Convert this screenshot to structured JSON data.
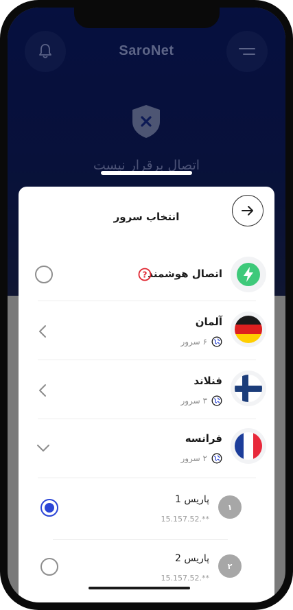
{
  "header": {
    "brand": "SaroNet",
    "status": "اتصال برقرار نیست"
  },
  "sheet": {
    "title": "انتخاب سرور"
  },
  "smart": {
    "label": "اتصال هوشمند",
    "help_glyph": "?"
  },
  "countries": [
    {
      "name": "آلمان",
      "servers": "۶ سرور",
      "expanded": false
    },
    {
      "name": "فنلاند",
      "servers": "۳ سرور",
      "expanded": false
    },
    {
      "name": "فرانسه",
      "servers": "۲ سرور",
      "expanded": true
    }
  ],
  "subservers": [
    {
      "name": "پاریس 1",
      "ip": "15.157.52.**",
      "badge": "۱",
      "selected": true
    },
    {
      "name": "پاریس 2",
      "ip": "15.157.52.**",
      "badge": "۲",
      "selected": false
    }
  ],
  "colors": {
    "accent": "#2b45d6",
    "smart_green": "#3ec97a",
    "help_red": "#e0242f",
    "header_navy": "#0b1a66"
  }
}
